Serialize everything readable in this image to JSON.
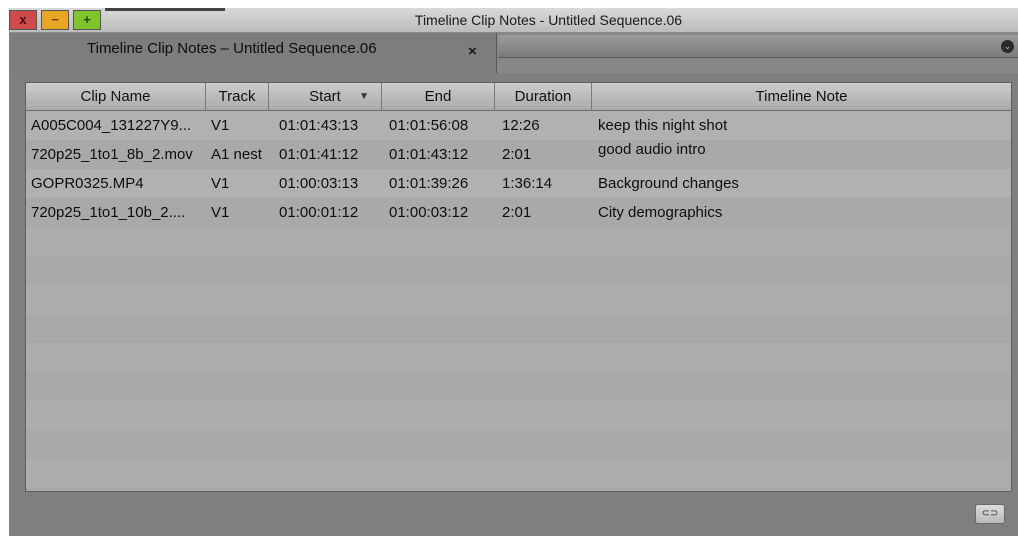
{
  "window": {
    "title": "Timeline Clip Notes - Untitled Sequence.06",
    "close_glyph": "x",
    "minimize_glyph": "−",
    "maximize_glyph": "+"
  },
  "tab": {
    "label": "Timeline Clip Notes – Untitled Sequence.06",
    "close_glyph": "×",
    "menu_glyph": "⌄"
  },
  "table": {
    "columns": [
      "Clip Name",
      "Track",
      "Start",
      "End",
      "Duration",
      "Timeline Note"
    ],
    "sort_column": "Start",
    "sort_glyph": "▼",
    "rows": [
      {
        "clip": "A005C004_131227Y9...",
        "track": "V1",
        "start": "01:01:43:13",
        "end": "01:01:56:08",
        "duration": "12:26",
        "note": "keep this night shot"
      },
      {
        "clip": "720p25_1to1_8b_2.mov",
        "track": "A1 nest",
        "start": "01:01:41:12",
        "end": "01:01:43:12",
        "duration": "2:01",
        "note": "good audio intro"
      },
      {
        "clip": "GOPR0325.MP4",
        "track": "V1",
        "start": "01:00:03:13",
        "end": "01:01:39:26",
        "duration": "1:36:14",
        "note": "Background changes"
      },
      {
        "clip": "720p25_1to1_10b_2....",
        "track": "V1",
        "start": "01:00:01:12",
        "end": "01:00:03:12",
        "duration": "2:01",
        "note": "City demographics"
      }
    ]
  },
  "footer": {
    "button_icon": "link-icon",
    "button_glyph": "⊂⊃"
  }
}
